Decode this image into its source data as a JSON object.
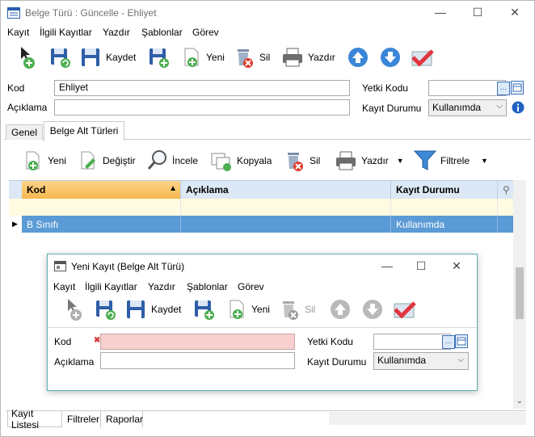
{
  "window": {
    "title": "Belge Türü : Güncelle - Ehliyet",
    "controls": {
      "minimize": "—",
      "maximize": "☐",
      "close": "✕"
    }
  },
  "menu": [
    "Kayıt",
    "İlgili Kayıtlar",
    "Yazdır",
    "Şablonlar",
    "Görev"
  ],
  "toolbar": {
    "save_label": "Kaydet",
    "new_label": "Yeni",
    "delete_label": "Sil",
    "print_label": "Yazdır"
  },
  "form": {
    "kod_label": "Kod",
    "kod_value": "Ehliyet",
    "aciklama_label": "Açıklama",
    "aciklama_value": "",
    "yetki_label": "Yetki Kodu",
    "yetki_value": "",
    "durum_label": "Kayıt Durumu",
    "durum_value": "Kullanımda"
  },
  "tabs": [
    "Genel",
    "Belge Alt Türleri"
  ],
  "subtoolbar": {
    "new_label": "Yeni",
    "edit_label": "Değiştir",
    "view_label": "İncele",
    "copy_label": "Kopyala",
    "delete_label": "Sil",
    "print_label": "Yazdır",
    "filter_label": "Filtrele"
  },
  "grid": {
    "columns": [
      "Kod",
      "Açıklama",
      "Kayıt Durumu"
    ],
    "rows": [
      {
        "kod": "B Sınıfı",
        "aciklama": "",
        "durum": "Kullanımda"
      }
    ]
  },
  "dialog": {
    "title": "Yeni Kayıt (Belge Alt Türü)",
    "menu": [
      "Kayıt",
      "İlgili Kayıtlar",
      "Yazdır",
      "Şablonlar",
      "Görev"
    ],
    "toolbar": {
      "save_label": "Kaydet",
      "new_label": "Yeni",
      "delete_label": "Sil"
    },
    "form": {
      "kod_label": "Kod",
      "kod_value": "",
      "aciklama_label": "Açıklama",
      "aciklama_value": "",
      "yetki_label": "Yetki Kodu",
      "yetki_value": "",
      "durum_label": "Kayıt Durumu",
      "durum_value": "Kullanımda"
    }
  },
  "bottom_tabs": [
    "Kayıt Listesi",
    "Filtreler",
    "Raporlar"
  ],
  "colors": {
    "accent_header": "#f7b84f",
    "selected_row": "#5b9bd5",
    "grid_header": "#dce8f5",
    "new_row": "#fefbe0",
    "error_field": "#f8d0d0"
  }
}
